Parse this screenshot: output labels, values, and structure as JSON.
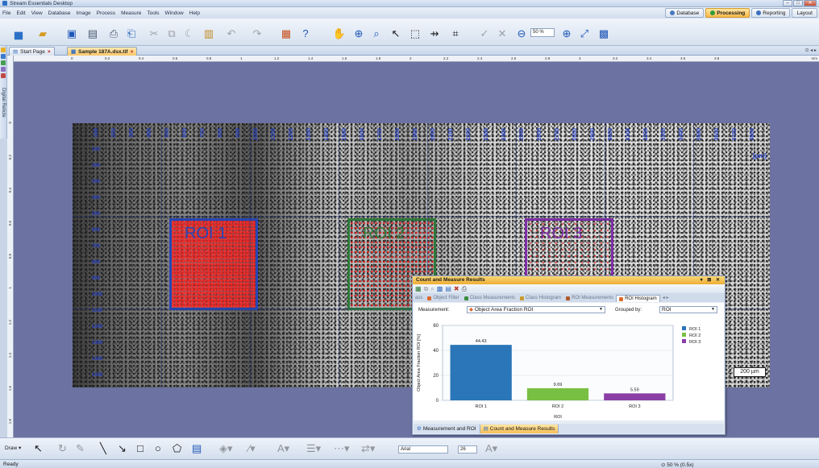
{
  "window": {
    "title": "Stream Essentials Desktop"
  },
  "menu": [
    "File",
    "Edit",
    "View",
    "Database",
    "Image",
    "Process",
    "Measure",
    "Tools",
    "Window",
    "Help"
  ],
  "modes": [
    {
      "label": "Database",
      "active": false
    },
    {
      "label": "Processing",
      "active": true
    },
    {
      "label": "Reporting",
      "active": false
    },
    {
      "label": "Layout",
      "active": false
    }
  ],
  "toolbar": {
    "zoom_value": "50 %"
  },
  "left_strip": {
    "label": "Digital Reticle"
  },
  "doc_tabs": [
    {
      "label": "Start Page",
      "active": false
    },
    {
      "label": "Sample 187A.dsx.tif",
      "active": true
    }
  ],
  "ruler": {
    "h_labels": [
      "0",
      "0.2",
      "0.4",
      "0.6",
      "0.8",
      "1",
      "1.2",
      "1.4",
      "1.6",
      "1.8",
      "2",
      "2.2",
      "2.4",
      "2.6",
      "2.8",
      "3",
      "3.2",
      "3.4",
      "3.6",
      "3.8"
    ],
    "h_unit": "mm",
    "v_labels": [
      "0",
      "0.2",
      "0.4",
      "0.6",
      "0.8",
      "1",
      "1.2",
      "1.4",
      "1.6",
      "1.8"
    ]
  },
  "image": {
    "scale_h": [
      "100",
      "200",
      "300",
      "400",
      "500",
      "600",
      "700",
      "800",
      "900",
      "1000",
      "1100",
      "1200",
      "1300",
      "1400",
      "1500",
      "1600",
      "1700",
      "1800",
      "1900",
      "2000",
      "2100",
      "2200",
      "2300",
      "2400",
      "2500",
      "2600",
      "2700",
      "2800",
      "2900",
      "3000",
      "3100",
      "3200",
      "3300",
      "3400",
      "3500",
      "3600",
      "3700",
      "3800"
    ],
    "scale_v": [
      "100",
      "200",
      "300",
      "400",
      "500",
      "600",
      "700",
      "800",
      "900",
      "1000",
      "1100",
      "1200",
      "1300",
      "1400",
      "1500"
    ],
    "unit": "[µm]",
    "rois": [
      "ROI 1",
      "ROI 2",
      "ROI 3"
    ],
    "scalebar": "200 µm"
  },
  "results_panel": {
    "title": "Count and Measure Results",
    "title_controls": "▾ ⊠ ✕",
    "tabs": [
      {
        "label": "ass",
        "active": false
      },
      {
        "label": "Object Filter",
        "active": false
      },
      {
        "label": "Class Measurements",
        "active": false
      },
      {
        "label": "Class Histogram",
        "active": false
      },
      {
        "label": "ROI Measurements",
        "active": false
      },
      {
        "label": "ROI Histogram",
        "active": true
      }
    ],
    "measurement_label": "Measurement:",
    "measurement_value": "Object Area Fraction ROI",
    "grouped_label": "Grouped by:",
    "grouped_value": "ROI",
    "bottom_tabs": [
      {
        "label": "Measurement and ROI",
        "active": false
      },
      {
        "label": "Count and Measure Results",
        "active": true
      }
    ]
  },
  "chart_data": {
    "type": "bar",
    "categories": [
      "ROI 1",
      "ROI 2",
      "ROI 3"
    ],
    "values": [
      44.43,
      9.69,
      5.59
    ],
    "value_labels": [
      "44.43",
      "9.69",
      "5.59"
    ],
    "colors": [
      "#2a76b8",
      "#78c043",
      "#8b3fa6"
    ],
    "xlabel": "ROI",
    "ylabel": "Object Area Fraction ROI [%]",
    "ylim": [
      0,
      60
    ],
    "yticks": [
      0,
      20,
      40,
      60
    ],
    "legend": [
      "ROI 1",
      "ROI 2",
      "ROI 3"
    ],
    "legend_position": "right"
  },
  "draw_toolbar": {
    "draw_label": "Draw ▾",
    "font_value": "Arial",
    "font_size": "26"
  },
  "status": {
    "left": "Ready",
    "zoom": "50 % (0.5x)"
  }
}
